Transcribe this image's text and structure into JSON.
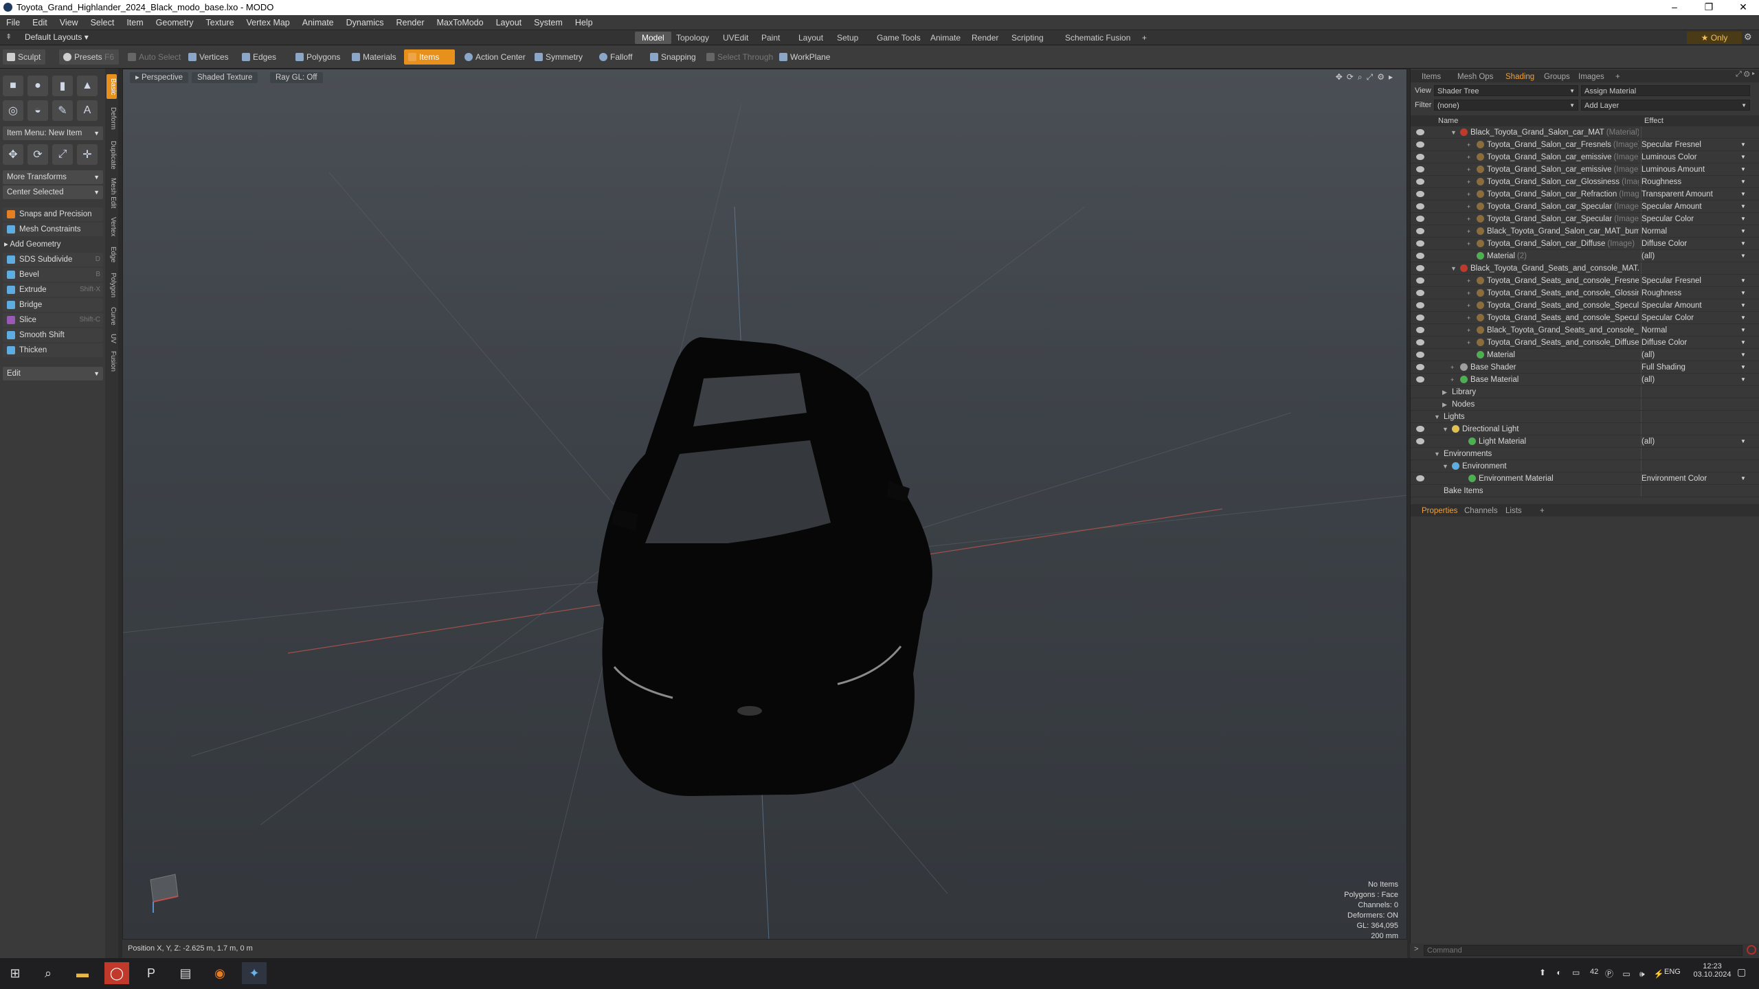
{
  "window": {
    "title": "Toyota_Grand_Highlander_2024_Black_modo_base.lxo - MODO"
  },
  "menu": [
    "File",
    "Edit",
    "View",
    "Select",
    "Item",
    "Geometry",
    "Texture",
    "Vertex Map",
    "Animate",
    "Dynamics",
    "Render",
    "MaxToModo",
    "Layout",
    "System",
    "Help"
  ],
  "layout": {
    "default": "Default Layouts",
    "tabs": [
      "Model",
      "Topology",
      "UVEdit",
      "Paint",
      "Layout",
      "Setup",
      "Game Tools",
      "Animate",
      "Render",
      "Scripting",
      "Schematic Fusion"
    ],
    "plus": "+",
    "only": "Only"
  },
  "toolbar": {
    "sculpt": "Sculpt",
    "presets": "Presets",
    "presets_key": "F6",
    "auto_select": "Auto Select",
    "vertices": "Vertices",
    "edges": "Edges",
    "polygons": "Polygons",
    "materials": "Materials",
    "items": "Items",
    "action_center": "Action Center",
    "symmetry": "Symmetry",
    "falloff": "Falloff",
    "snapping": "Snapping",
    "select_through": "Select Through",
    "workplane": "WorkPlane"
  },
  "left": {
    "item_menu": "Item Menu: New Item",
    "more_transforms": "More Transforms",
    "center_selected": "Center Selected",
    "snaps": "Snaps and Precision",
    "mesh_constraints": "Mesh Constraints",
    "add_geometry": "Add Geometry",
    "tools": [
      {
        "label": "SDS Subdivide",
        "key": "D"
      },
      {
        "label": "Bevel",
        "key": "B"
      },
      {
        "label": "Extrude",
        "key": "Shift-X"
      },
      {
        "label": "Bridge",
        "key": ""
      },
      {
        "label": "Slice",
        "key": "Shift-C"
      },
      {
        "label": "Smooth Shift",
        "key": ""
      },
      {
        "label": "Thicken",
        "key": ""
      }
    ],
    "edit": "Edit",
    "vtabs": [
      "Basic",
      "Deform",
      "Duplicate",
      "Mesh Edit",
      "Vertex",
      "Edge",
      "Polygon",
      "Curve",
      "UV",
      "Fusion"
    ]
  },
  "viewport": {
    "perspective": "Perspective",
    "shading": "Shaded Texture",
    "raygl": "Ray GL: Off",
    "hud": [
      "No Items",
      "Polygons : Face",
      "Channels: 0",
      "Deformers: ON",
      "GL: 364,095",
      "200 mm"
    ],
    "status": "Position X, Y, Z:  -2.625 m, 1.7 m, 0 m"
  },
  "right": {
    "tabs": [
      "Items",
      "Mesh Ops",
      "Shading",
      "Groups",
      "Images",
      "+"
    ],
    "view_label": "View",
    "view_value": "Shader Tree",
    "assign": "Assign Material",
    "filter_label": "Filter",
    "filter_value": "(none)",
    "add_layer": "Add Layer",
    "col_name": "Name",
    "col_effect": "Effect",
    "tree": [
      {
        "name": "Black_Toyota_Grand_Salon_car_MAT",
        "type": "(Material)",
        "effect": "",
        "ind": 3,
        "exp": "▼",
        "c": "#c0392b"
      },
      {
        "name": "Toyota_Grand_Salon_car_Fresnels",
        "type": "(Image)",
        "effect": "Specular Fresnel",
        "ind": 5,
        "exp": "+",
        "c": "#8a6d3b"
      },
      {
        "name": "Toyota_Grand_Salon_car_emissive",
        "type": "(Image)",
        "effect": "Luminous Color",
        "ind": 5,
        "exp": "+",
        "c": "#8a6d3b"
      },
      {
        "name": "Toyota_Grand_Salon_car_emissive",
        "type": "(Image)",
        "effect": "Luminous Amount",
        "ind": 5,
        "exp": "+",
        "c": "#8a6d3b"
      },
      {
        "name": "Toyota_Grand_Salon_car_Glossiness",
        "type": "(Image)",
        "effect": "Roughness",
        "ind": 5,
        "exp": "+",
        "c": "#8a6d3b"
      },
      {
        "name": "Toyota_Grand_Salon_car_Refraction",
        "type": "(Image)",
        "effect": "Transparent Amount",
        "ind": 5,
        "exp": "+",
        "c": "#8a6d3b"
      },
      {
        "name": "Toyota_Grand_Salon_car_Specular",
        "type": "(Image)",
        "effect": "Specular Amount",
        "ind": 5,
        "exp": "+",
        "c": "#8a6d3b"
      },
      {
        "name": "Toyota_Grand_Salon_car_Specular",
        "type": "(Image)",
        "effect": "Specular Color",
        "ind": 5,
        "exp": "+",
        "c": "#8a6d3b"
      },
      {
        "name": "Black_Toyota_Grand_Salon_car_MAT_bump ...",
        "type": "",
        "effect": "Normal",
        "ind": 5,
        "exp": "+",
        "c": "#8a6d3b"
      },
      {
        "name": "Toyota_Grand_Salon_car_Diffuse",
        "type": "(Image)",
        "effect": "Diffuse Color",
        "ind": 5,
        "exp": "+",
        "c": "#8a6d3b"
      },
      {
        "name": "Material",
        "type": "(2)",
        "effect": "(all)",
        "ind": 5,
        "exp": "",
        "c": "#4caf50"
      },
      {
        "name": "Black_Toyota_Grand_Seats_and_console_MAT...",
        "type": "",
        "effect": "",
        "ind": 3,
        "exp": "▼",
        "c": "#c0392b"
      },
      {
        "name": "Toyota_Grand_Seats_and_console_Fresnel",
        "type": "",
        "effect": "Specular Fresnel",
        "ind": 5,
        "exp": "+",
        "c": "#8a6d3b"
      },
      {
        "name": "Toyota_Grand_Seats_and_console_Glossine...",
        "type": "",
        "effect": "Roughness",
        "ind": 5,
        "exp": "+",
        "c": "#8a6d3b"
      },
      {
        "name": "Toyota_Grand_Seats_and_console_Specula ...",
        "type": "",
        "effect": "Specular Amount",
        "ind": 5,
        "exp": "+",
        "c": "#8a6d3b"
      },
      {
        "name": "Toyota_Grand_Seats_and_console_Specular",
        "type": "",
        "effect": "Specular Color",
        "ind": 5,
        "exp": "+",
        "c": "#8a6d3b"
      },
      {
        "name": "Black_Toyota_Grand_Seats_and_console_M...",
        "type": "",
        "effect": "Normal",
        "ind": 5,
        "exp": "+",
        "c": "#8a6d3b"
      },
      {
        "name": "Toyota_Grand_Seats_and_console_Diffuse",
        "type": "",
        "effect": "Diffuse Color",
        "ind": 5,
        "exp": "+",
        "c": "#8a6d3b"
      },
      {
        "name": "Material",
        "type": "",
        "effect": "(all)",
        "ind": 5,
        "exp": "",
        "c": "#4caf50"
      },
      {
        "name": "Base Shader",
        "type": "",
        "effect": "Full Shading",
        "ind": 3,
        "exp": "+",
        "c": "#9e9e9e"
      },
      {
        "name": "Base Material",
        "type": "",
        "effect": "(all)",
        "ind": 3,
        "exp": "+",
        "c": "#4caf50"
      },
      {
        "name": "Library",
        "type": "",
        "effect": "",
        "ind": 2,
        "exp": "▶",
        "c": "",
        "noeye": true
      },
      {
        "name": "Nodes",
        "type": "",
        "effect": "",
        "ind": 2,
        "exp": "▶",
        "c": "",
        "noeye": true
      },
      {
        "name": "Lights",
        "type": "",
        "effect": "",
        "ind": 1,
        "exp": "▼",
        "c": "",
        "noeye": true
      },
      {
        "name": "Directional Light",
        "type": "",
        "effect": "",
        "ind": 2,
        "exp": "▼",
        "c": "#e0c050"
      },
      {
        "name": "Light Material",
        "type": "",
        "effect": "(all)",
        "ind": 4,
        "exp": "",
        "c": "#4caf50"
      },
      {
        "name": "Environments",
        "type": "",
        "effect": "",
        "ind": 1,
        "exp": "▼",
        "c": "",
        "noeye": true
      },
      {
        "name": "Environment",
        "type": "",
        "effect": "",
        "ind": 2,
        "exp": "▼",
        "c": "#5dade2",
        "noeye": true
      },
      {
        "name": "Environment Material",
        "type": "",
        "effect": "Environment Color",
        "ind": 4,
        "exp": "",
        "c": "#4caf50"
      },
      {
        "name": "Bake Items",
        "type": "",
        "effect": "",
        "ind": 1,
        "exp": "",
        "c": "",
        "noeye": true
      }
    ],
    "bottom_tabs": [
      "Properties",
      "Channels",
      "Lists",
      "+"
    ],
    "command_placeholder": "Command"
  },
  "taskbar": {
    "time": "12:23",
    "date": "03.10.2024",
    "lang": "ENG",
    "temp": "42"
  },
  "colors": {
    "accent": "#e8901c"
  }
}
